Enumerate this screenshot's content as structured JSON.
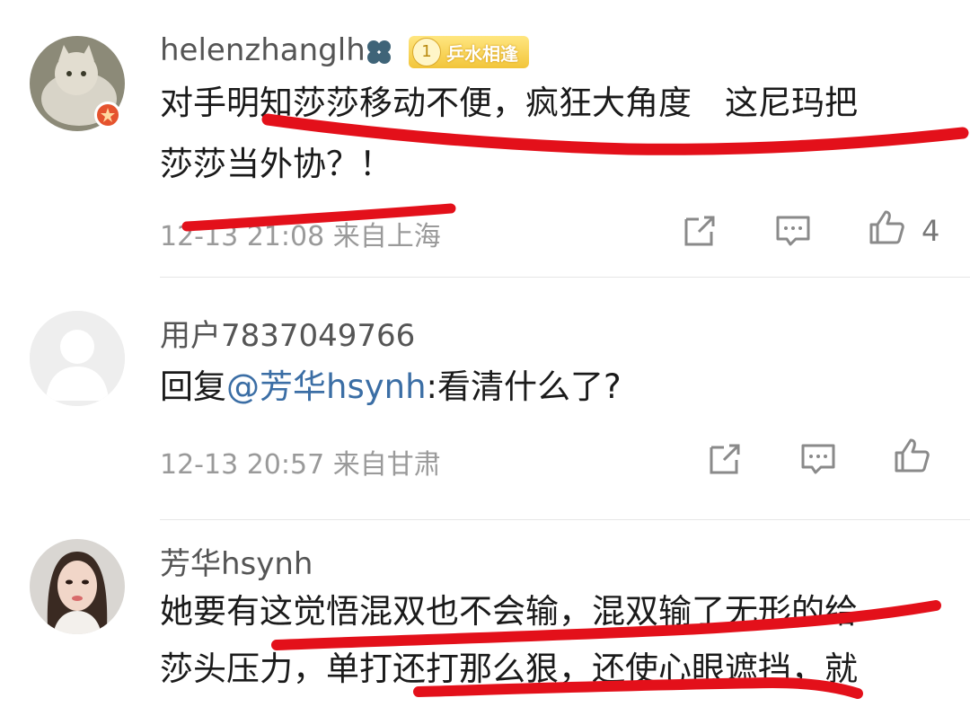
{
  "comments": [
    {
      "username": "helenzhanglh",
      "badge_level": "1",
      "badge_label": "乒水相逢",
      "line1": "对手明知莎莎移动不便，疯狂大角度　这尼玛把",
      "line2": "莎莎当外协？！",
      "meta": "12-13 21:08 来自上海",
      "like_count": "4"
    },
    {
      "username": "用户7837049766",
      "reply_prefix": "回复",
      "mention": "@芳华hsynh",
      "reply_text": ":看清什么了?",
      "meta": "12-13 20:57 来自甘肃"
    },
    {
      "username": "芳华hsynh",
      "line1": "她要有这觉悟混双也不会输，混双输了无形的给",
      "line2": "莎头压力，单打还打那么狠，还使心眼遮挡，就"
    }
  ],
  "icons": [
    "clover-icon",
    "share-icon",
    "comment-icon",
    "like-icon"
  ],
  "colors": {
    "annotation": "#e3101a",
    "mention": "#3b6ea5",
    "badge": "#f2c53a"
  }
}
